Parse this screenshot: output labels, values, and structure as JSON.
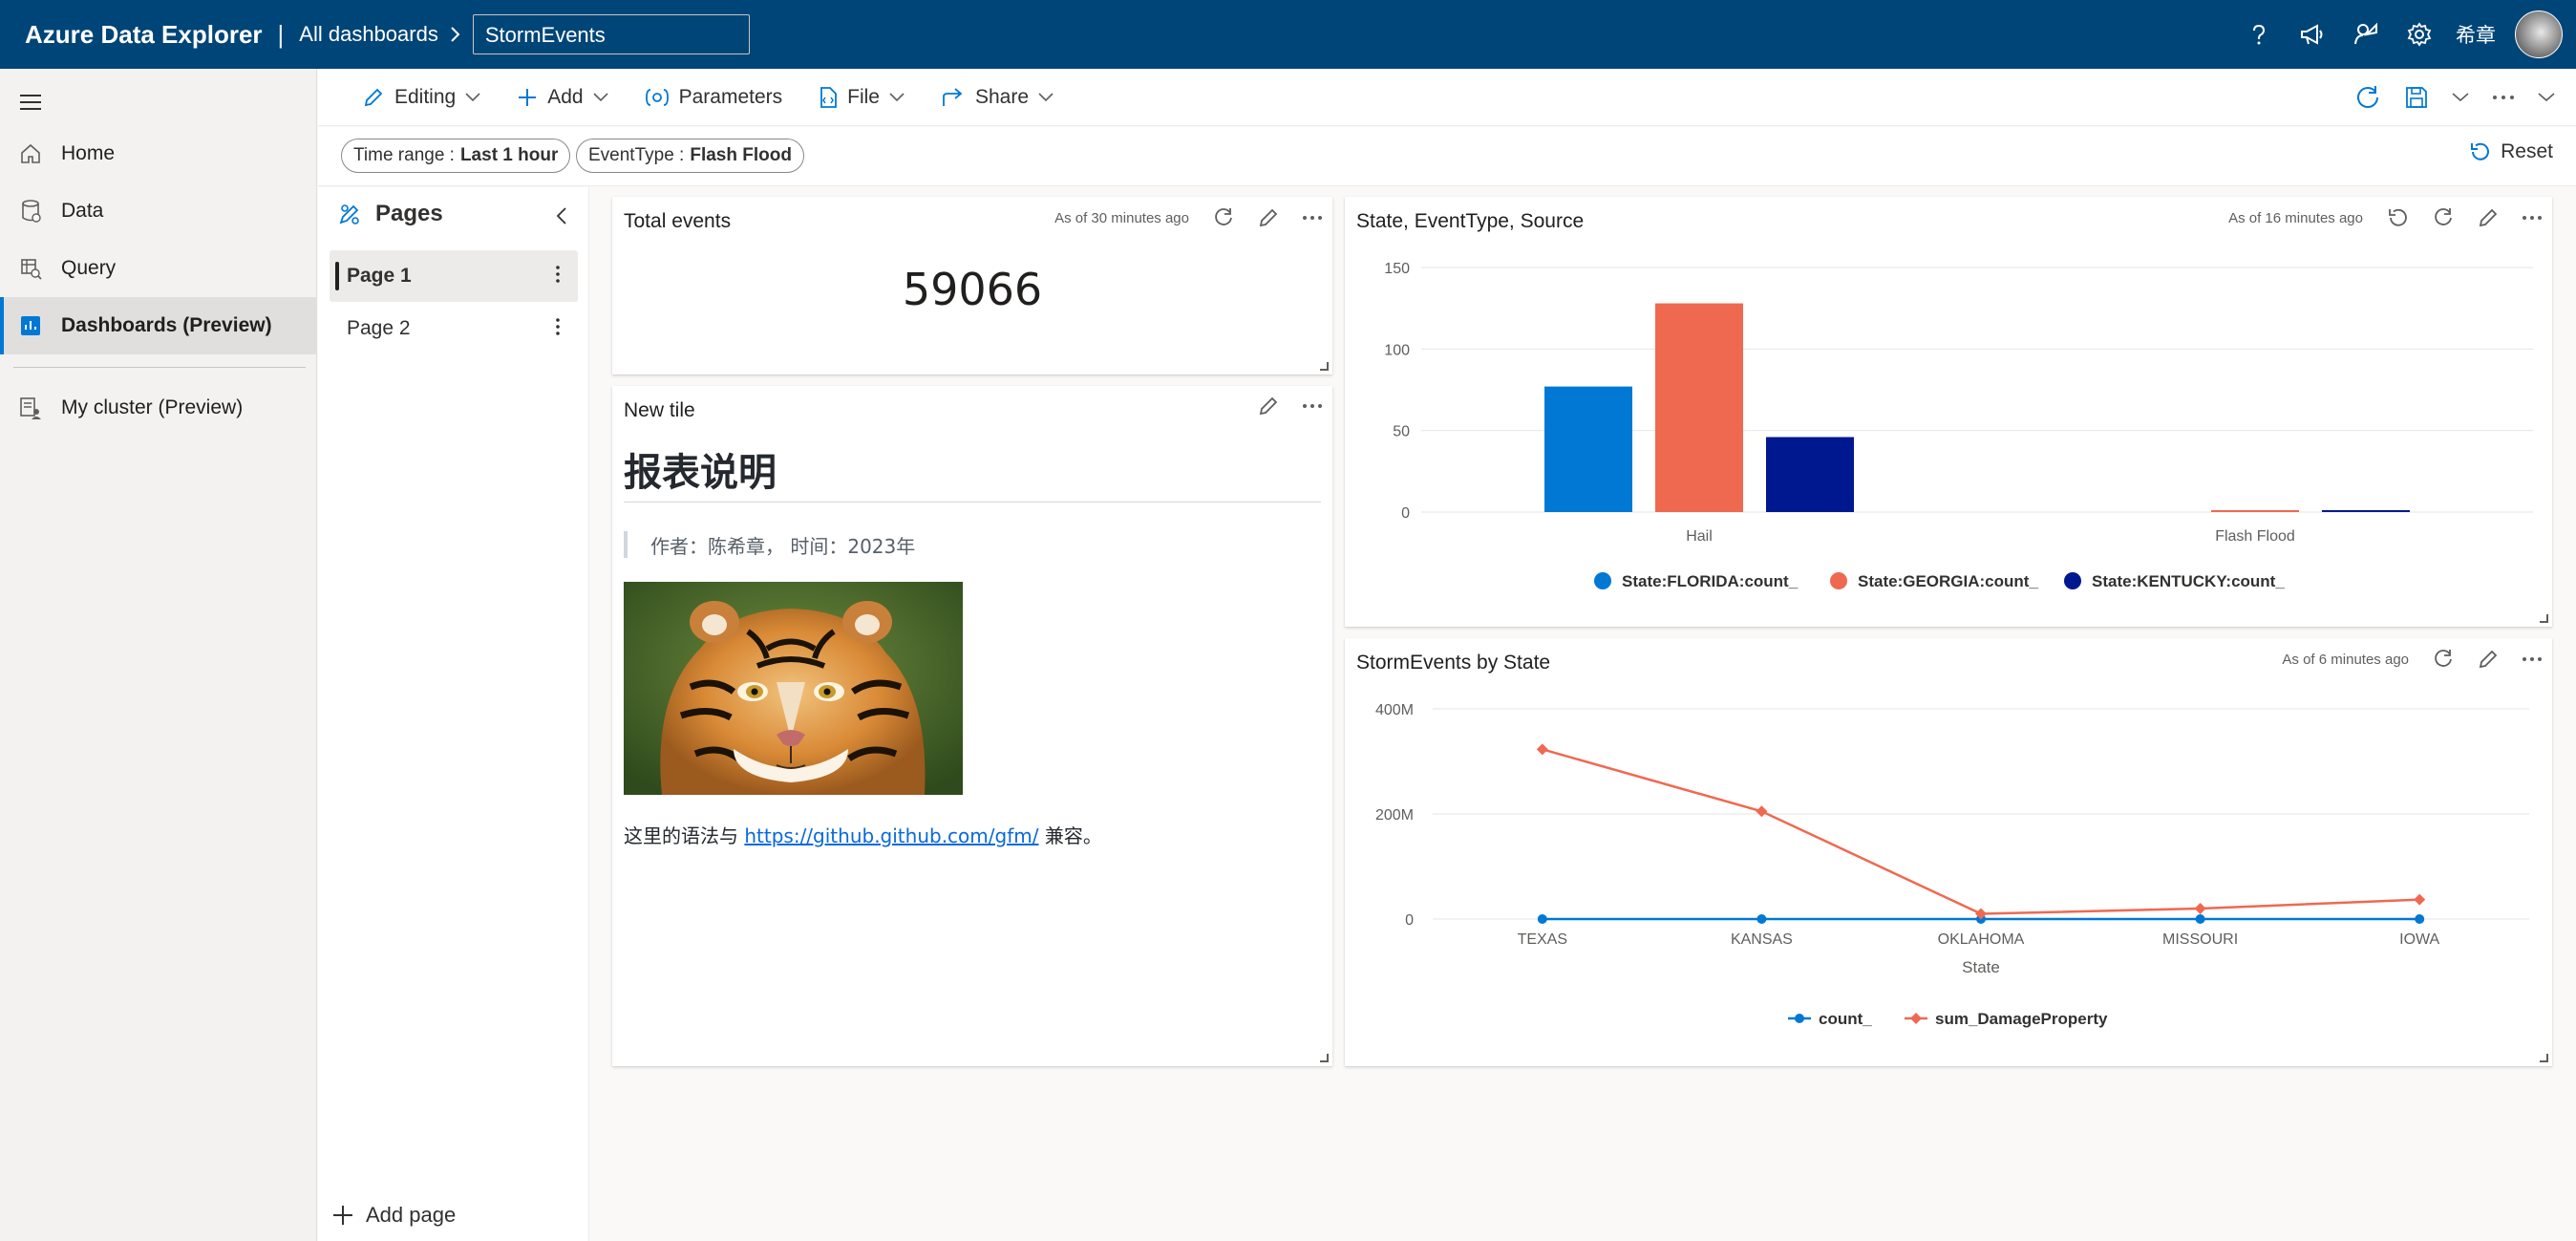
{
  "app": {
    "title": "Azure Data Explorer",
    "separator": "|",
    "breadcrumb": "All dashboards",
    "dashboard_name": "StormEvents",
    "user_name": "希章"
  },
  "nav": {
    "home": "Home",
    "data": "Data",
    "query": "Query",
    "dashboards": "Dashboards (Preview)",
    "my_cluster": "My cluster (Preview)"
  },
  "toolbar": {
    "editing": "Editing",
    "add": "Add",
    "parameters": "Parameters",
    "file": "File",
    "share": "Share"
  },
  "filters": {
    "time_range_label": "Time range :",
    "time_range_value": "Last 1 hour",
    "event_type_label": "EventType :",
    "event_type_value": "Flash Flood",
    "reset": "Reset"
  },
  "pages": {
    "title": "Pages",
    "items": [
      "Page 1",
      "Page 2"
    ],
    "active": "Page 1",
    "add_page": "Add page"
  },
  "tiles": {
    "total_events": {
      "title": "Total events",
      "as_of": "As of 30 minutes ago",
      "value": "59066"
    },
    "new_tile": {
      "title": "New tile",
      "heading": "报表说明",
      "quote": "作者：陈希章， 时间：2023年",
      "text_before": "这里的语法与 ",
      "link": "https://github.github.com/gfm/",
      "text_after": " 兼容。"
    },
    "state_chart": {
      "title": "State, EventType, Source",
      "as_of": "As of 16 minutes ago"
    },
    "storm_chart": {
      "title": "StormEvents by State",
      "as_of": "As of 6 minutes ago"
    }
  },
  "colors": {
    "topbar": "#004578",
    "accent": "#0078d4",
    "florida": "#0078d4",
    "georgia": "#ef6950",
    "kentucky": "#00188f"
  },
  "chart_data": [
    {
      "type": "bar",
      "title": "State, EventType, Source",
      "categories": [
        "Hail",
        "Flash Flood"
      ],
      "series": [
        {
          "name": "State:FLORIDA:count_",
          "values": [
            77,
            0
          ]
        },
        {
          "name": "State:GEORGIA:count_",
          "values": [
            128,
            1
          ]
        },
        {
          "name": "State:KENTUCKY:count_",
          "values": [
            46,
            1
          ]
        }
      ],
      "yticks": [
        0,
        50,
        100,
        150
      ],
      "ylim": [
        0,
        150
      ],
      "legend": "bottom",
      "grid": true
    },
    {
      "type": "line",
      "title": "StormEvents by State",
      "categories": [
        "TEXAS",
        "KANSAS",
        "OKLAHOMA",
        "MISSOURI",
        "IOWA"
      ],
      "xlabel": "State",
      "series": [
        {
          "name": "count_",
          "values": [
            4701,
            3166,
            2690,
            2016,
            2337
          ]
        },
        {
          "name": "sum_DamageProperty",
          "values": [
            323000000,
            205000000,
            10000000,
            20000000,
            37000000
          ]
        }
      ],
      "yticks": [
        "0",
        "200M",
        "400M"
      ],
      "ylim": [
        0,
        400000000
      ],
      "legend": "bottom",
      "grid": true
    }
  ]
}
